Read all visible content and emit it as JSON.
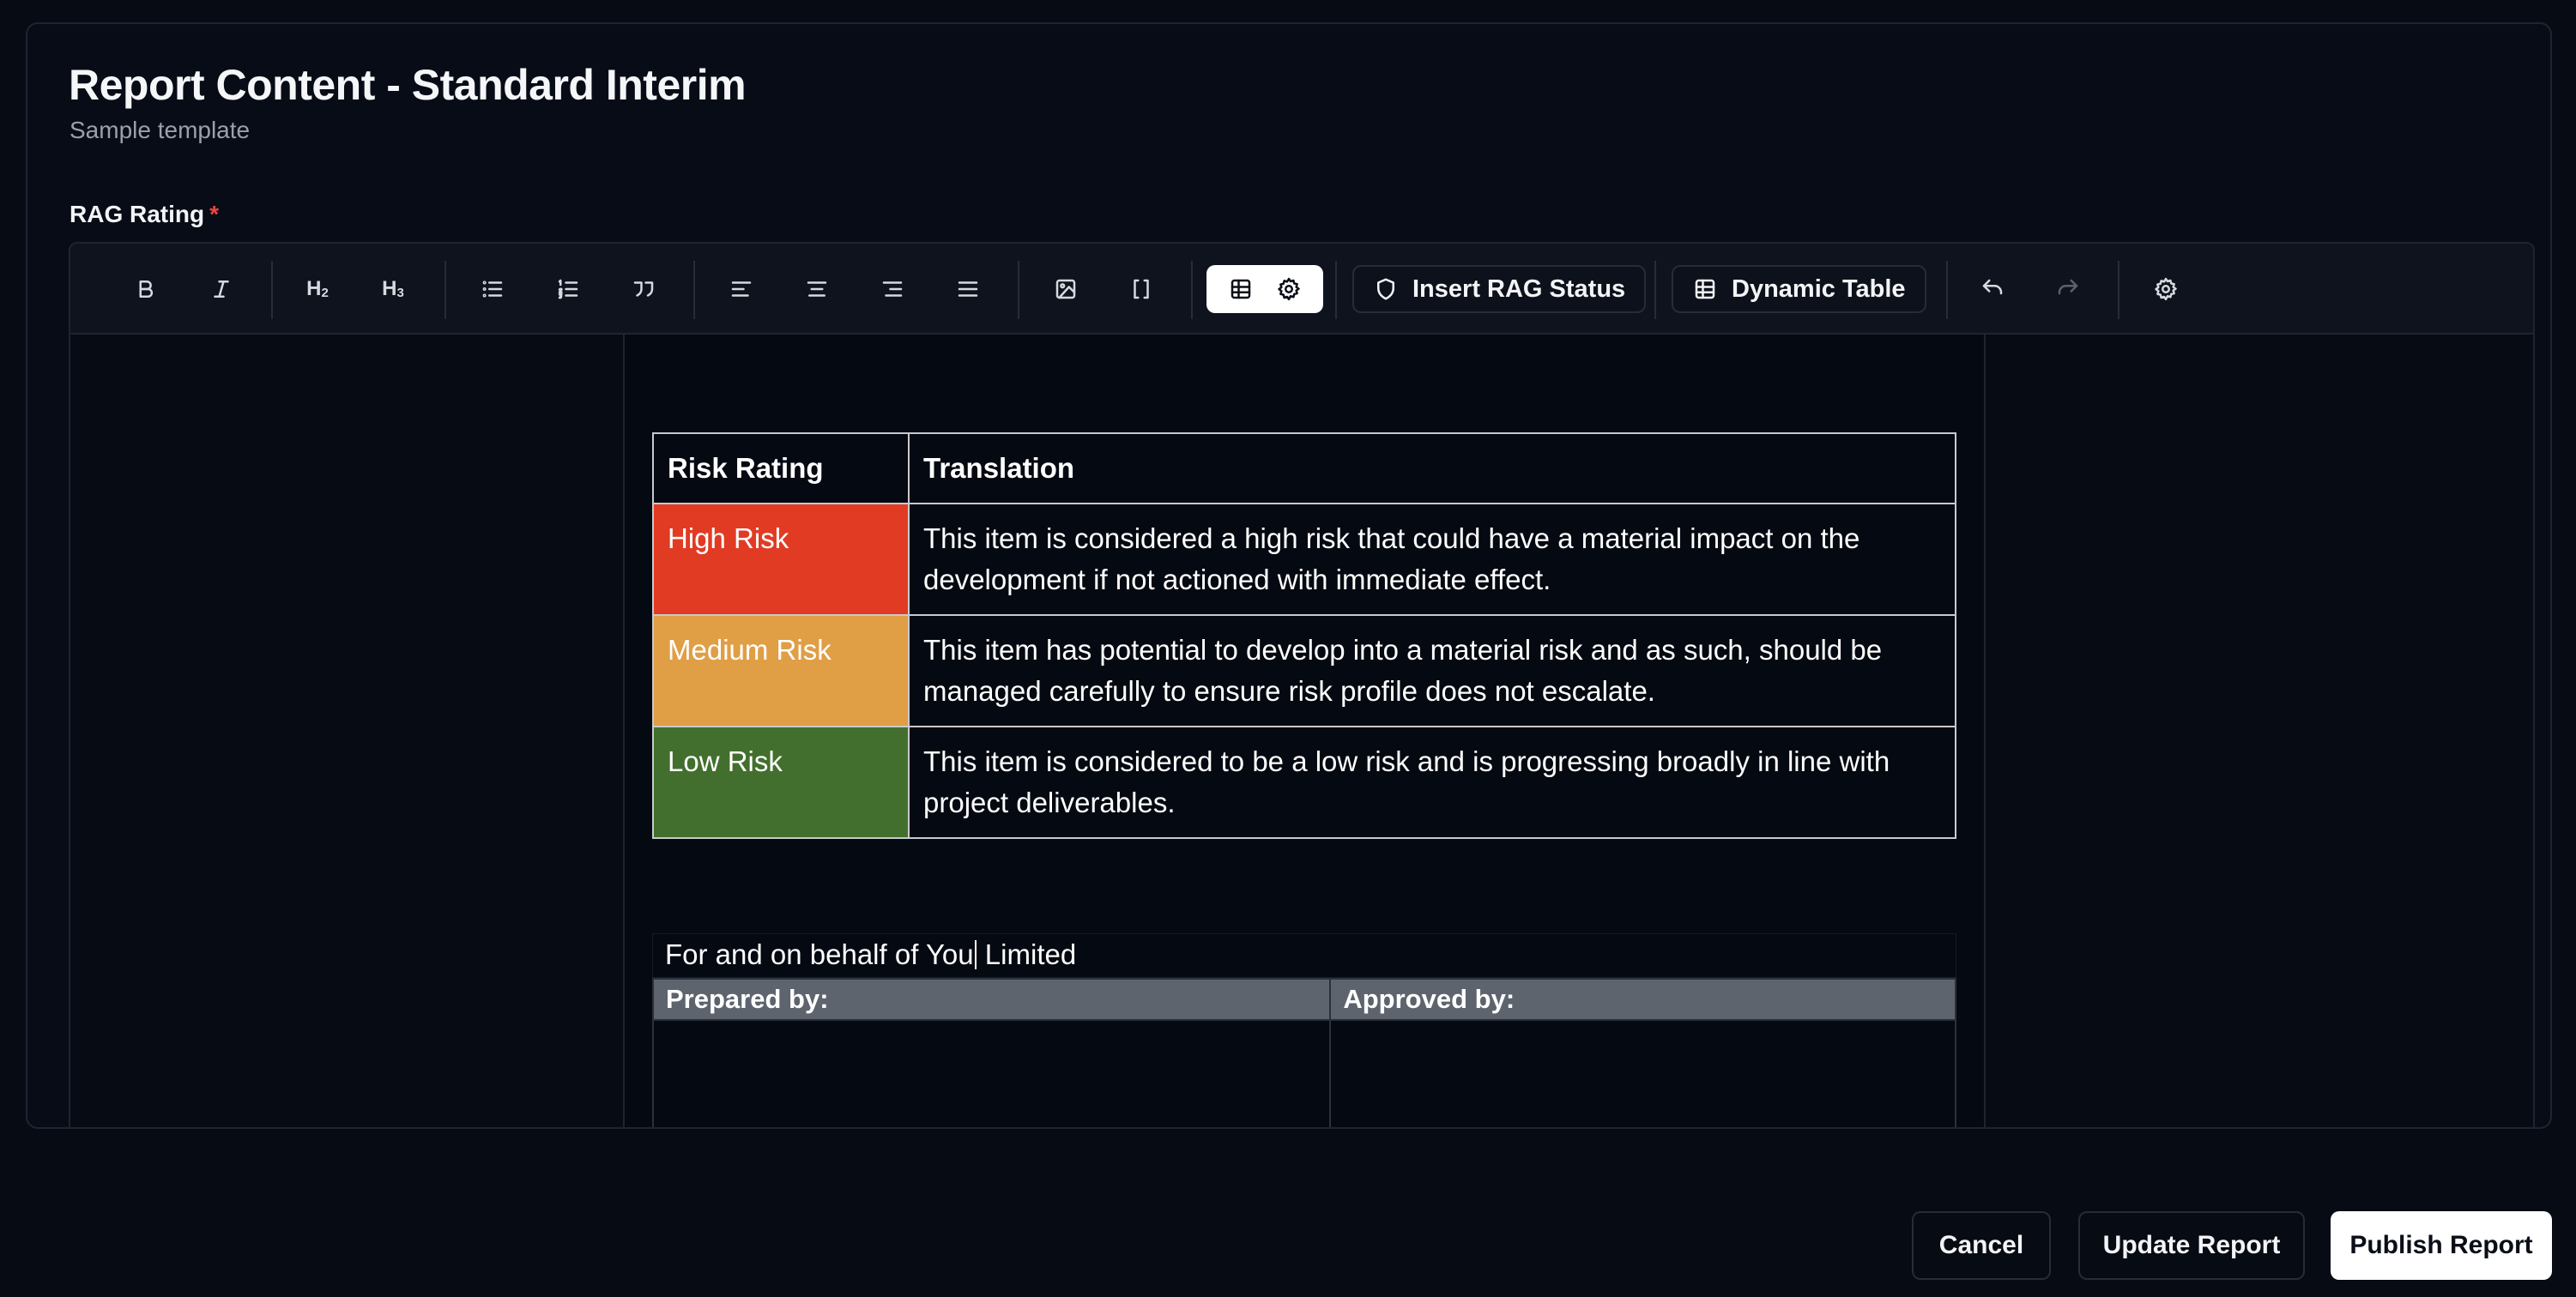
{
  "header": {
    "title": "Report Content - Standard Interim",
    "subtitle": "Sample template"
  },
  "field": {
    "label": "RAG Rating",
    "required_mark": "*"
  },
  "toolbar": {
    "h2": "H",
    "h2_sub": "2",
    "h3": "H",
    "h3_sub": "3",
    "insert_rag_label": "Insert RAG Status",
    "dynamic_table_label": "Dynamic Table"
  },
  "table": {
    "headers": [
      "Risk Rating",
      "Translation"
    ],
    "rows": [
      {
        "rating": "High Risk",
        "color": "#e23b24",
        "translation": "This item is considered a high risk that could have a material impact on the development if not actioned with immediate effect."
      },
      {
        "rating": "Medium Risk",
        "color": "#e09e45",
        "translation": "This item has potential to develop into a material risk and as such, should be managed carefully to ensure risk profile does not escalate."
      },
      {
        "rating": "Low Risk",
        "color": "#426f2d",
        "translation": "This item is considered to be a low risk and is progressing broadly in line with project deliverables."
      }
    ]
  },
  "signature": {
    "line_before_cursor": "For and on behalf of You",
    "line_after_cursor": " Limited",
    "prepared_by": "Prepared by:",
    "approved_by": "Approved by:"
  },
  "actions": {
    "cancel": "Cancel",
    "update": "Update Report",
    "publish": "Publish Report"
  }
}
